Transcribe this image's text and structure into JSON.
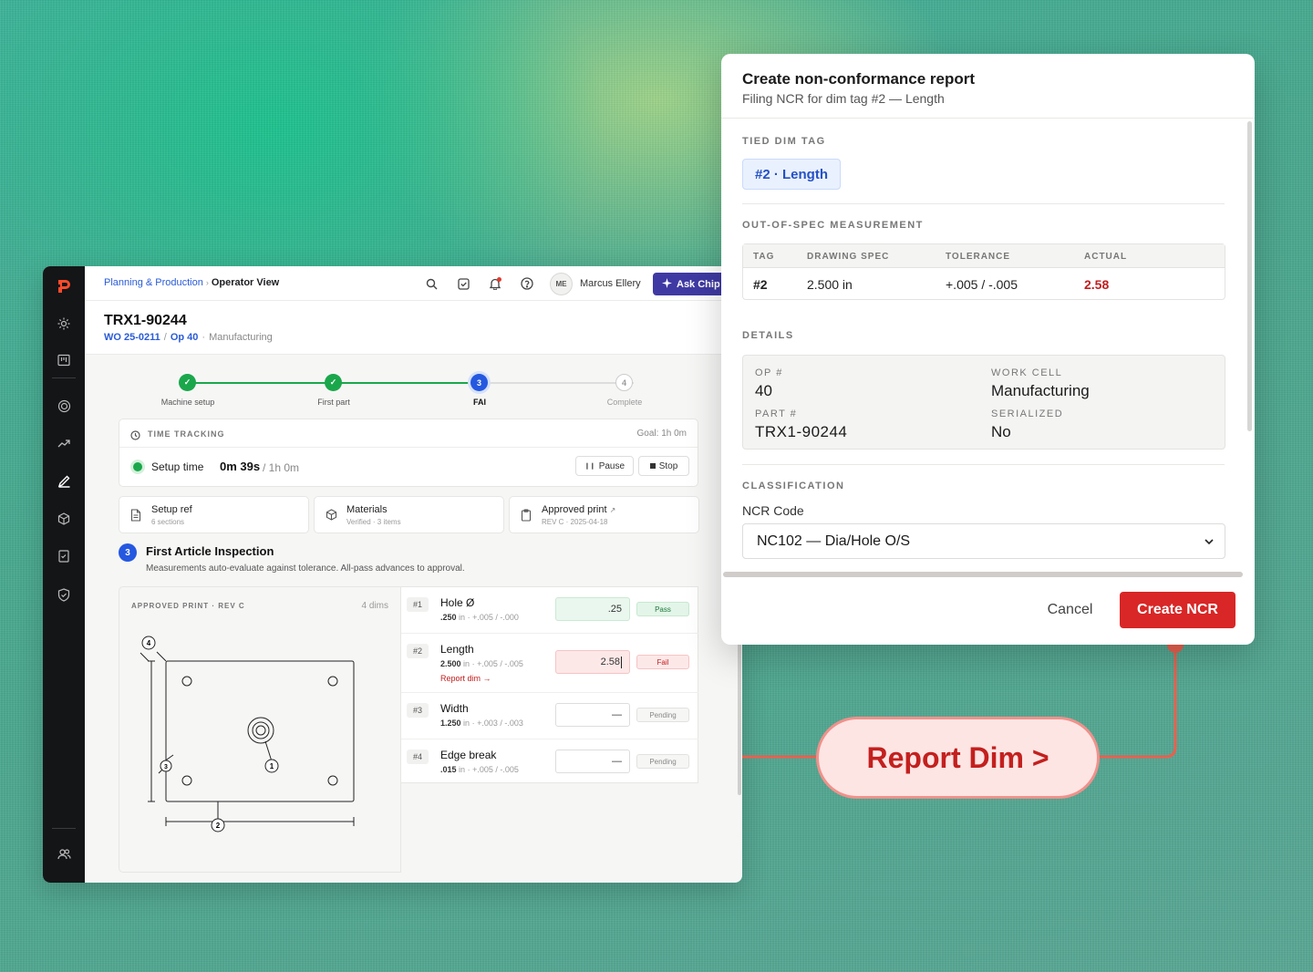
{
  "app": {
    "breadcrumb": {
      "parent": "Planning & Production",
      "current": "Operator View"
    },
    "user": {
      "initials": "ME",
      "name": "Marcus Ellery"
    },
    "ask_button": "Ask Chip",
    "rail_icons": [
      "logo-icon",
      "sun-icon",
      "board-icon",
      "target-icon",
      "trend-icon",
      "pen-icon",
      "cube-icon",
      "checklist-icon",
      "shield-icon",
      "users-icon"
    ],
    "work_order": {
      "title": "TRX1-90244",
      "wo": "WO 25-0211",
      "sep": "/",
      "op": "Op 40",
      "dot": "·",
      "area": "Manufacturing"
    },
    "steps": [
      {
        "label": "Machine setup",
        "state": "done"
      },
      {
        "label": "First part",
        "state": "done"
      },
      {
        "label": "FAI",
        "state": "current",
        "num": "3"
      },
      {
        "label": "Complete",
        "state": "todo",
        "num": "4"
      }
    ],
    "time_tracking": {
      "label": "TIME TRACKING",
      "goal": "Goal: 1h 0m",
      "setup_label": "Setup time",
      "setup_value": "0m 39s",
      "setup_goal": "/ 1h 0m",
      "pause": "Pause",
      "stop": "Stop"
    },
    "refs": [
      {
        "title": "Setup ref",
        "sub": "6 sections",
        "icon": "document-icon"
      },
      {
        "title": "Materials",
        "sub": "Verified · 3 items",
        "icon": "box-icon"
      },
      {
        "title": "Approved print",
        "sub": "REV C · 2025-04-18",
        "icon": "clipboard-icon"
      }
    ],
    "fai": {
      "num": "3",
      "title": "First Article Inspection",
      "desc": "Measurements auto-evaluate against tolerance. All-pass advances to approval."
    },
    "print": {
      "header": "APPROVED PRINT · REV C",
      "count": "4 dims",
      "callouts": [
        "4",
        "3",
        "1",
        "2"
      ]
    },
    "dims": [
      {
        "tag": "#1",
        "name": "Hole Ø",
        "nominal": ".250",
        "unit": "in",
        "tol": "· +.005 / -.000",
        "value": ".25",
        "status": "Pass"
      },
      {
        "tag": "#2",
        "name": "Length",
        "nominal": "2.500",
        "unit": "in",
        "tol": "· +.005 / -.005",
        "value": "2.58",
        "status": "Fail",
        "report": "Report dim →"
      },
      {
        "tag": "#3",
        "name": "Width",
        "nominal": "1.250",
        "unit": "in",
        "tol": "· +.003 / -.003",
        "value": "—",
        "status": "Pending"
      },
      {
        "tag": "#4",
        "name": "Edge break",
        "nominal": ".015",
        "unit": "in",
        "tol": "· +.005 / -.005",
        "value": "—",
        "status": "Pending"
      }
    ],
    "colors": {
      "accent": "#2558e0",
      "success": "#1aa74b",
      "danger": "#d92626",
      "ask": "#3f3aa3"
    }
  },
  "modal": {
    "title": "Create non-conformance report",
    "subtitle": "Filing NCR for dim tag #2 — Length",
    "tied_label": "TIED DIM TAG",
    "tied_chip": "#2 · Length",
    "oos_label": "OUT-OF-SPEC MEASUREMENT",
    "table": {
      "headers": [
        "TAG",
        "DRAWING SPEC",
        "TOLERANCE",
        "ACTUAL"
      ],
      "row": [
        "#2",
        "2.500 in",
        "+.005 / -.005",
        "2.58"
      ]
    },
    "details_label": "DETAILS",
    "details": [
      {
        "label": "OP #",
        "value": "40"
      },
      {
        "label": "WORK CELL",
        "value": "Manufacturing"
      },
      {
        "label": "PART #",
        "value": "TRX1-90244"
      },
      {
        "label": "SERIALIZED",
        "value": "No"
      }
    ],
    "class_label": "CLASSIFICATION",
    "ncr_code_label": "NCR Code",
    "ncr_code_value": "NC102 — Dia/Hole O/S",
    "cancel": "Cancel",
    "create": "Create NCR"
  },
  "callout": {
    "label": "Report Dim >",
    "color": "#e8604f"
  }
}
